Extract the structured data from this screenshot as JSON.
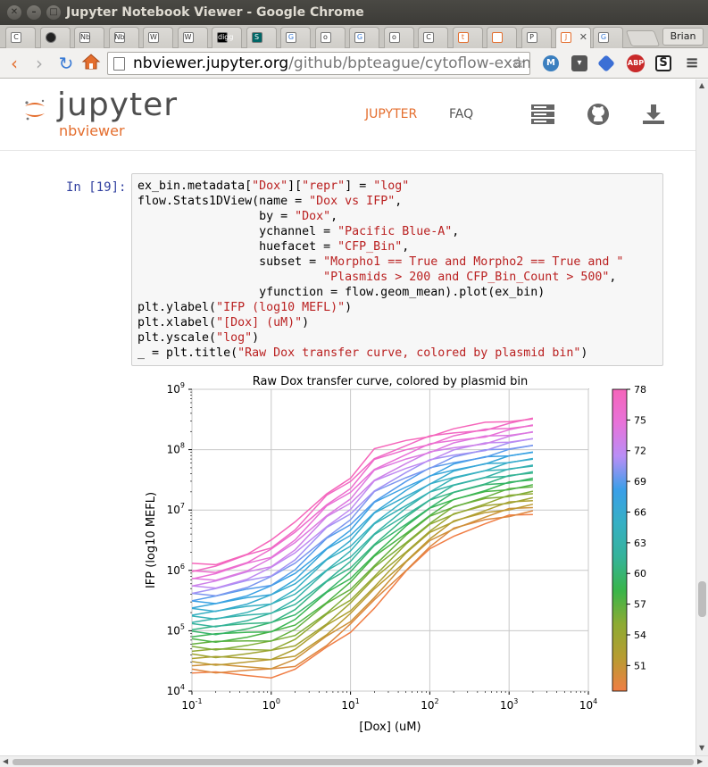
{
  "window": {
    "title": "Jupyter Notebook Viewer - Google Chrome"
  },
  "tabs": [
    {
      "label": "C",
      "icon": "page-icon"
    },
    {
      "label": "",
      "icon": "github-icon"
    },
    {
      "label": "Nb",
      "icon": "nb-icon"
    },
    {
      "label": "Nb",
      "icon": "nb-icon"
    },
    {
      "label": "W",
      "icon": "wikipedia-icon"
    },
    {
      "label": "W",
      "icon": "wikipedia-icon"
    },
    {
      "label": "digg",
      "icon": "digg-icon"
    },
    {
      "label": "S",
      "icon": "slashdot-icon"
    },
    {
      "label": "G",
      "icon": "google-icon"
    },
    {
      "label": "o",
      "icon": "puzzle-icon"
    },
    {
      "label": "G",
      "icon": "google-icon"
    },
    {
      "label": "o",
      "icon": "puzzle-icon"
    },
    {
      "label": "C",
      "icon": "page-icon"
    },
    {
      "label": "t",
      "icon": "jupyter-icon"
    },
    {
      "label": "",
      "icon": "jupyter-icon"
    },
    {
      "label": "P",
      "icon": "page-icon"
    },
    {
      "label": "J",
      "icon": "jupyter-icon",
      "active": true
    },
    {
      "label": "G",
      "icon": "google-icon"
    }
  ],
  "profile": {
    "name": "Brian"
  },
  "omnibox": {
    "host": "nbviewer.jupyter.org",
    "path": "/github/bpteague/cytoflow-examples/l"
  },
  "header": {
    "logo_word": "jupyter",
    "logo_sub": "nbviewer",
    "nav": [
      {
        "label": "JUPYTER",
        "color": "#e46e2e"
      },
      {
        "label": "FAQ",
        "color": "#555555"
      }
    ]
  },
  "cell": {
    "prompt": "In [19]:",
    "lines": [
      [
        {
          "t": "ex_bin.metadata["
        },
        {
          "t": "\"Dox\"",
          "s": 1
        },
        {
          "t": "]["
        },
        {
          "t": "\"repr\"",
          "s": 1
        },
        {
          "t": "] = "
        },
        {
          "t": "\"log\"",
          "s": 1
        }
      ],
      [
        {
          "t": "flow.Stats1DView(name = "
        },
        {
          "t": "\"Dox vs IFP\"",
          "s": 1
        },
        {
          "t": ","
        }
      ],
      [
        {
          "t": "                 by = "
        },
        {
          "t": "\"Dox\"",
          "s": 1
        },
        {
          "t": ","
        }
      ],
      [
        {
          "t": "                 ychannel = "
        },
        {
          "t": "\"Pacific Blue-A\"",
          "s": 1
        },
        {
          "t": ","
        }
      ],
      [
        {
          "t": "                 huefacet = "
        },
        {
          "t": "\"CFP_Bin\"",
          "s": 1
        },
        {
          "t": ","
        }
      ],
      [
        {
          "t": "                 subset = "
        },
        {
          "t": "\"Morpho1 == True and Morpho2 == True and \"",
          "s": 1
        }
      ],
      [
        {
          "t": "                          "
        },
        {
          "t": "\"Plasmids > 200 and CFP_Bin_Count > 500\"",
          "s": 1
        },
        {
          "t": ","
        }
      ],
      [
        {
          "t": "                 yfunction = flow.geom_mean).plot(ex_bin)"
        }
      ],
      [
        {
          "t": "plt.ylabel("
        },
        {
          "t": "\"IFP (log10 MEFL)\"",
          "s": 1
        },
        {
          "t": ")"
        }
      ],
      [
        {
          "t": "plt.xlabel("
        },
        {
          "t": "\"[Dox] (uM)\"",
          "s": 1
        },
        {
          "t": ")"
        }
      ],
      [
        {
          "t": "plt.yscale("
        },
        {
          "t": "\"log\"",
          "s": 1
        },
        {
          "t": ")"
        }
      ],
      [
        {
          "t": "_ = plt.title("
        },
        {
          "t": "\"Raw Dox transfer curve, colored by plasmid bin\"",
          "s": 1
        },
        {
          "t": ")"
        }
      ]
    ]
  },
  "chart_data": {
    "type": "line",
    "title": "Raw Dox transfer curve, colored by plasmid bin",
    "xlabel": "[Dox] (uM)",
    "ylabel": "IFP (log10 MEFL)",
    "xscale": "log",
    "yscale": "log",
    "xlim": [
      0.1,
      10000
    ],
    "ylim": [
      10000,
      1000000000
    ],
    "xticks": [
      {
        "base": "10",
        "exp": "-1"
      },
      {
        "base": "10",
        "exp": "0"
      },
      {
        "base": "10",
        "exp": "1"
      },
      {
        "base": "10",
        "exp": "2"
      },
      {
        "base": "10",
        "exp": "3"
      },
      {
        "base": "10",
        "exp": "4"
      }
    ],
    "yticks": [
      {
        "base": "10",
        "exp": "4"
      },
      {
        "base": "10",
        "exp": "5"
      },
      {
        "base": "10",
        "exp": "6"
      },
      {
        "base": "10",
        "exp": "7"
      },
      {
        "base": "10",
        "exp": "8"
      },
      {
        "base": "10",
        "exp": "9"
      }
    ],
    "grid": true,
    "x": [
      0.1,
      0.2,
      0.5,
      1,
      2,
      5,
      10,
      20,
      50,
      100,
      200,
      500,
      1000,
      2000
    ],
    "series_hue_range": [
      49,
      78
    ],
    "low_curve": [
      20000,
      19000,
      18500,
      18000,
      22000,
      50000,
      100000,
      250000,
      900000,
      2200000,
      4000000,
      6000000,
      7500000,
      8500000
    ],
    "high_curve": [
      1200000,
      1300000,
      2000000,
      3000000,
      6000000,
      20000000,
      35000000,
      95000000,
      140000000,
      180000000,
      220000000,
      260000000,
      300000000,
      350000000
    ],
    "colorbar": {
      "ticks": [
        "78",
        "75",
        "72",
        "69",
        "66",
        "63",
        "60",
        "57",
        "54",
        "51"
      ],
      "colors": [
        "#f565ba",
        "#e872d9",
        "#b98ef6",
        "#3a9fe8",
        "#36b0c4",
        "#35b39a",
        "#39b54a",
        "#8dab33",
        "#b79c31",
        "#f07e45"
      ]
    }
  }
}
